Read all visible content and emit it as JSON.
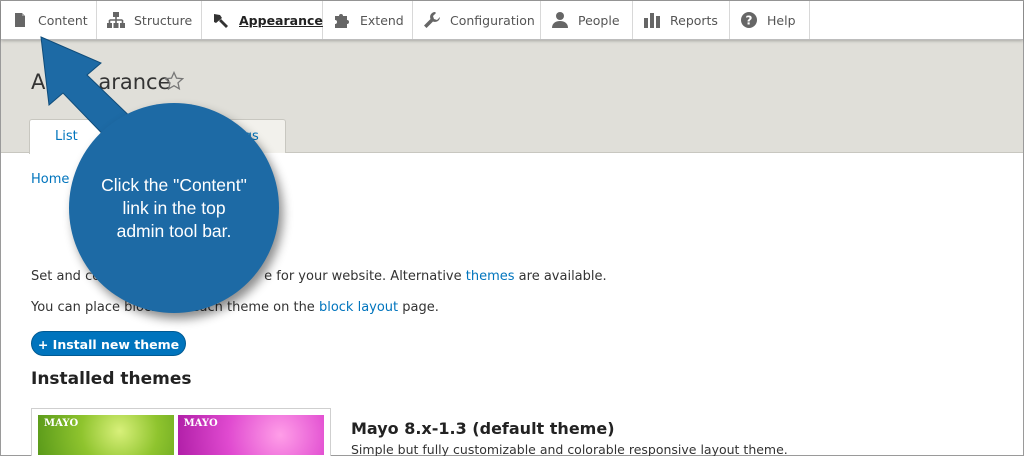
{
  "toolbar": {
    "items": [
      {
        "label": "Content",
        "icon": "page-icon"
      },
      {
        "label": "Structure",
        "icon": "sitemap-icon"
      },
      {
        "label": "Appearance",
        "icon": "paintbrush-icon"
      },
      {
        "label": "Extend",
        "icon": "puzzle-icon"
      },
      {
        "label": "Configuration",
        "icon": "wrench-icon"
      },
      {
        "label": "People",
        "icon": "person-icon"
      },
      {
        "label": "Reports",
        "icon": "bar-chart-icon"
      },
      {
        "label": "Help",
        "icon": "question-icon"
      }
    ]
  },
  "header": {
    "title_visible_start": "A",
    "title_visible_end": "arance",
    "tabs": [
      {
        "label": "List"
      },
      {
        "label": "ings"
      }
    ]
  },
  "breadcrumb": "Home",
  "content": {
    "line1_start": "Set and co",
    "line1_mid": "e for your website. Alternative ",
    "line1_link": "themes",
    "line1_end": " are available.",
    "line2_start": "You can place blocks for each theme on the ",
    "line2_link": "block layout",
    "line2_end": " page.",
    "install_button": "+ Install new theme",
    "section_title": "Installed themes",
    "theme_name": "Mayo 8.x-1.3 (default theme)",
    "theme_desc": "Simple but fully customizable and colorable responsive layout theme.",
    "thumb_label": "MAYO"
  },
  "callout": {
    "text": "Click the \"Content\" link in the top admin tool bar."
  },
  "colors": {
    "accent": "#0074bd",
    "callout": "#1d6aa5",
    "header_bg": "#e0dfd9"
  }
}
